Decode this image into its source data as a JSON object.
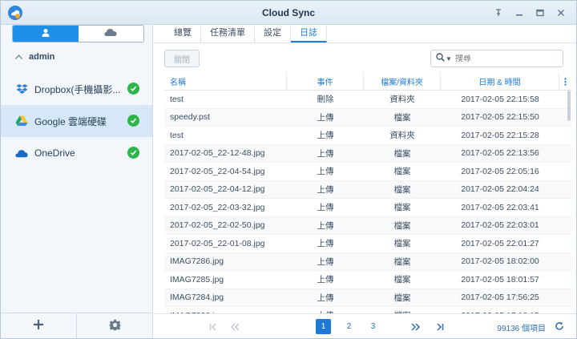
{
  "window": {
    "title": "Cloud Sync",
    "buttons": [
      "pin-icon",
      "minimize-icon",
      "maximize-icon",
      "close-icon"
    ]
  },
  "sidebar": {
    "tabs": [
      {
        "icon": "user-icon",
        "active": true
      },
      {
        "icon": "cloud-icon",
        "active": false
      }
    ],
    "group_label": "admin",
    "accounts": [
      {
        "label": "Dropbox(手機攝影...",
        "icon": "dropbox-icon",
        "status": "ok",
        "active": false
      },
      {
        "label": "Google 雲端硬碟",
        "icon": "google-drive-icon",
        "status": "ok",
        "active": true
      },
      {
        "label": "OneDrive",
        "icon": "onedrive-icon",
        "status": "ok",
        "active": false
      }
    ]
  },
  "tabs": [
    {
      "label": "總覽",
      "active": false
    },
    {
      "label": "任務清單",
      "active": false
    },
    {
      "label": "設定",
      "active": false
    },
    {
      "label": "日誌",
      "active": true
    }
  ],
  "toolbar": {
    "close_label": "關閉",
    "search_placeholder": "搜尋"
  },
  "table": {
    "headers": [
      "名稱",
      "事件",
      "檔案/資料夾",
      "日期 & 時間"
    ],
    "rows": [
      [
        "test",
        "刪除",
        "資料夾",
        "2017-02-05 22:15:58"
      ],
      [
        "speedy.pst",
        "上傳",
        "檔案",
        "2017-02-05 22:15:50"
      ],
      [
        "test",
        "上傳",
        "資料夾",
        "2017-02-05 22:15:28"
      ],
      [
        "2017-02-05_22-12-48.jpg",
        "上傳",
        "檔案",
        "2017-02-05 22:13:56"
      ],
      [
        "2017-02-05_22-04-54.jpg",
        "上傳",
        "檔案",
        "2017-02-05 22:05:16"
      ],
      [
        "2017-02-05_22-04-12.jpg",
        "上傳",
        "檔案",
        "2017-02-05 22:04:24"
      ],
      [
        "2017-02-05_22-03-32.jpg",
        "上傳",
        "檔案",
        "2017-02-05 22:03:41"
      ],
      [
        "2017-02-05_22-02-50.jpg",
        "上傳",
        "檔案",
        "2017-02-05 22:03:01"
      ],
      [
        "2017-02-05_22-01-08.jpg",
        "上傳",
        "檔案",
        "2017-02-05 22:01:27"
      ],
      [
        "IMAG7286.jpg",
        "上傳",
        "檔案",
        "2017-02-05 18:02:00"
      ],
      [
        "IMAG7285.jpg",
        "上傳",
        "檔案",
        "2017-02-05 18:01:57"
      ],
      [
        "IMAG7284.jpg",
        "上傳",
        "檔案",
        "2017-02-05 17:56:25"
      ],
      [
        "IMAG7283.jpg",
        "上傳",
        "檔案",
        "2017-02-05 17:18:15"
      ]
    ]
  },
  "pager": {
    "pages": [
      "1",
      "2",
      "3"
    ],
    "current": "1",
    "total_label": "99136 個項目"
  },
  "colors": {
    "accent": "#1e7ad6",
    "ok": "#2fb34a"
  }
}
